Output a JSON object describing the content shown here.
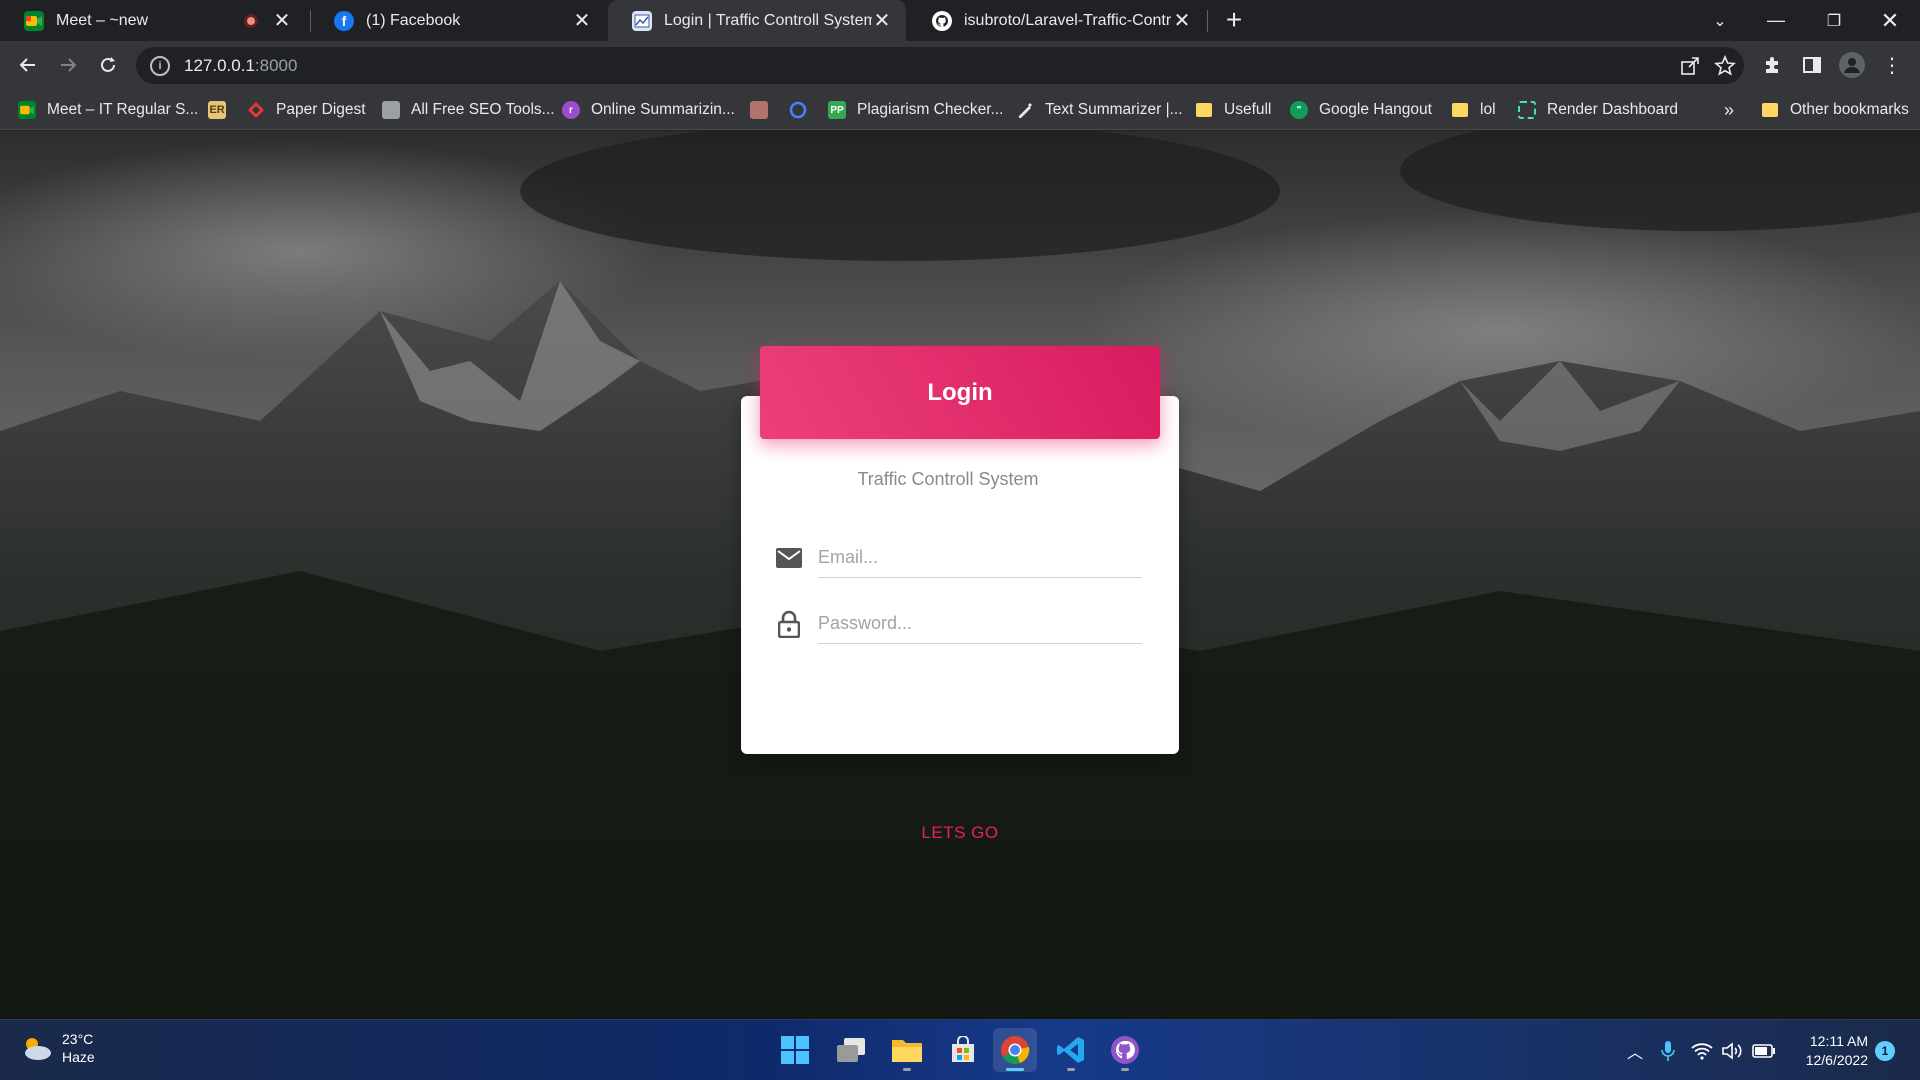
{
  "tabs": [
    {
      "title": "Meet – ~new",
      "icon": "google-meet-icon",
      "recording": true
    },
    {
      "title": "(1) Facebook",
      "icon": "facebook-icon"
    },
    {
      "title": "Login | Traffic Controll System",
      "icon": "site-icon",
      "active": true
    },
    {
      "title": "isubroto/Laravel-Traffic-Controll-",
      "icon": "github-icon"
    }
  ],
  "address_bar": {
    "host": "127.0.0.1",
    "port": ":8000"
  },
  "bookmarks": [
    {
      "label": "Meet – IT Regular S...",
      "icon": "google-meet-icon"
    },
    {
      "label": "",
      "icon": "er-icon",
      "badge": "ER"
    },
    {
      "label": "Paper Digest",
      "icon": "paper-digest-icon"
    },
    {
      "label": "All Free SEO Tools...",
      "icon": "seo-tools-icon"
    },
    {
      "label": "Online Summarizin...",
      "icon": "summarizer-icon"
    },
    {
      "label": "",
      "icon": "grid-icon"
    },
    {
      "label": "",
      "icon": "circle-logo-icon"
    },
    {
      "label": "Plagiarism Checker...",
      "icon": "plagiarism-icon",
      "badge": "PP"
    },
    {
      "label": "Text Summarizer |...",
      "icon": "pen-icon"
    },
    {
      "label": "Usefull",
      "icon": "folder-icon"
    },
    {
      "label": "Google Hangout",
      "icon": "hangouts-icon"
    },
    {
      "label": "lol",
      "icon": "folder-icon"
    },
    {
      "label": "Render Dashboard",
      "icon": "render-icon"
    }
  ],
  "bookmarks_overflow": "»",
  "other_bookmarks": "Other bookmarks",
  "login": {
    "header": "Login",
    "subtitle": "Traffic Controll System",
    "email_placeholder": "Email...",
    "password_placeholder": "Password...",
    "submit_label": "LETS GO"
  },
  "taskbar": {
    "weather_temp": "23°C",
    "weather_desc": "Haze",
    "time": "12:11 AM",
    "date": "12/6/2022",
    "notification_count": "1"
  },
  "colors": {
    "accent": "#e91e63",
    "header_gradient_start": "#ec407a",
    "header_gradient_end": "#d81b60"
  }
}
